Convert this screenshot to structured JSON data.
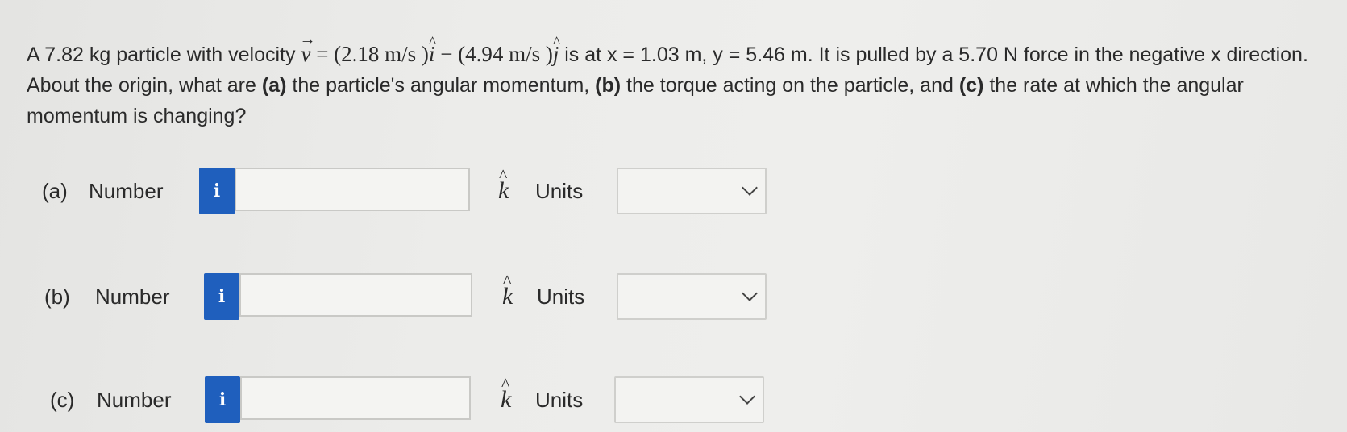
{
  "question": {
    "intro": "A 7.82 kg particle with velocity",
    "velocity_symbol": "v",
    "equals": "=",
    "comp1": "(2.18 m/s )",
    "i_symbol": "i",
    "minus": "−",
    "comp2": "(4.94 m/s )",
    "j_symbol": "j",
    "rest": "is at x = 1.03 m, y = 5.46 m. It is pulled by a 5.70 N force in the negative x direction. About the origin, what are",
    "part_a_marker": "(a)",
    "part_a_text": "the particle's angular momentum,",
    "part_b_marker": "(b)",
    "part_b_text": "the torque acting on the particle, and",
    "part_c_marker": "(c)",
    "part_c_text": "the rate at which the angular momentum is changing?"
  },
  "rows": [
    {
      "label": "(a)",
      "number_label": "Number",
      "info": "i",
      "value": "",
      "unit_vector": "k",
      "units_label": "Units",
      "units_value": ""
    },
    {
      "label": "(b)",
      "number_label": "Number",
      "info": "i",
      "value": "",
      "unit_vector": "k",
      "units_label": "Units",
      "units_value": ""
    },
    {
      "label": "(c)",
      "number_label": "Number",
      "info": "i",
      "value": "",
      "unit_vector": "k",
      "units_label": "Units",
      "units_value": ""
    }
  ],
  "colors": {
    "info_button": "#1f5fbd",
    "background": "#ececea"
  },
  "icons": {
    "info": "info-icon",
    "dropdown": "chevron-down-icon"
  }
}
